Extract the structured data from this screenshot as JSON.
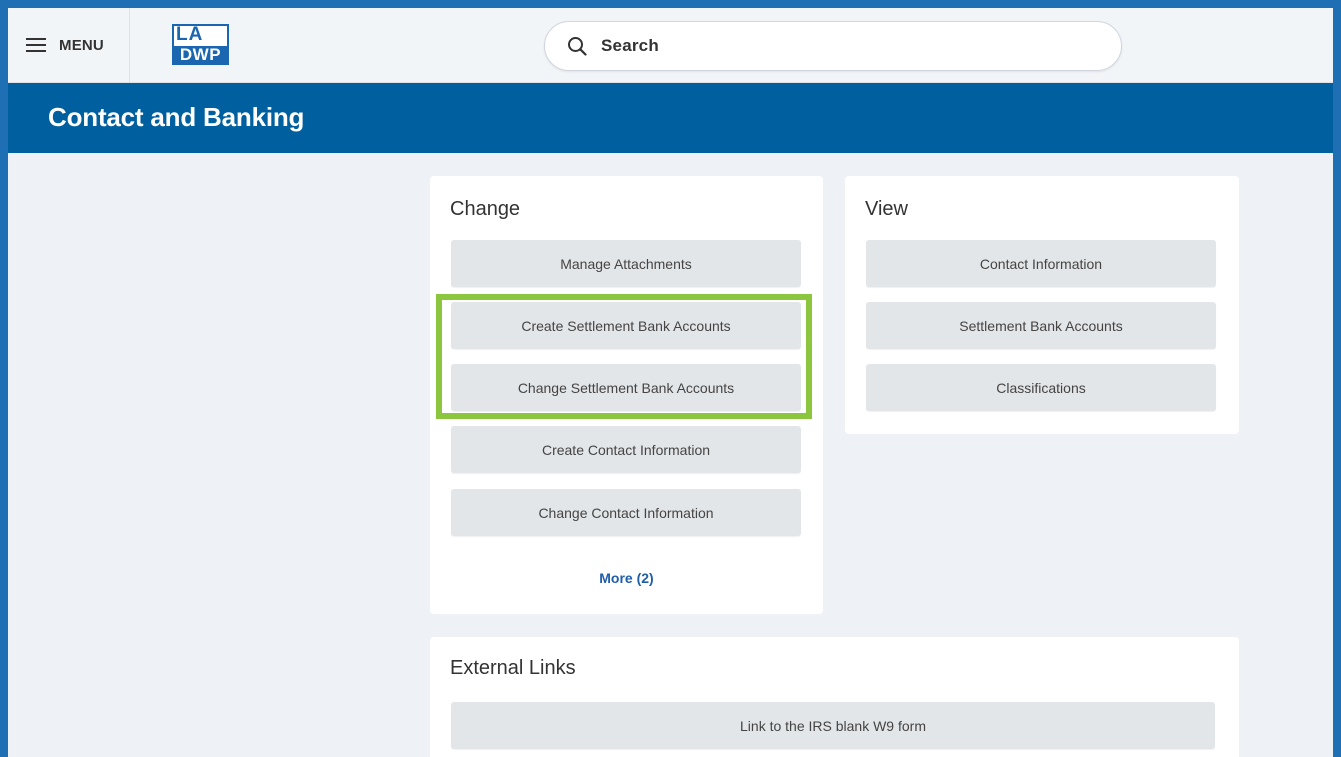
{
  "topbar": {
    "menu_label": "MENU",
    "logo": {
      "line1": "LA",
      "line2": "DWP"
    },
    "search": {
      "placeholder": "Search"
    }
  },
  "header": {
    "title": "Contact and Banking"
  },
  "change_card": {
    "title": "Change",
    "buttons": [
      {
        "label": "Manage Attachments"
      },
      {
        "label": "Create Settlement Bank Accounts"
      },
      {
        "label": "Change Settlement Bank Accounts"
      },
      {
        "label": "Create Contact Information"
      },
      {
        "label": "Change Contact Information"
      }
    ],
    "more_label": "More (2)"
  },
  "view_card": {
    "title": "View",
    "buttons": [
      {
        "label": "Contact Information"
      },
      {
        "label": "Settlement Bank Accounts"
      },
      {
        "label": "Classifications"
      }
    ]
  },
  "external_card": {
    "title": "External Links",
    "buttons": [
      {
        "label": "Link to the IRS blank W9 form"
      }
    ]
  },
  "colors": {
    "frame_border": "#1f6fb5",
    "banner": "#005f9e",
    "highlight": "#8cc63f",
    "link": "#1f5ea8"
  },
  "icons": [
    "hamburger-menu-icon",
    "search-icon"
  ]
}
